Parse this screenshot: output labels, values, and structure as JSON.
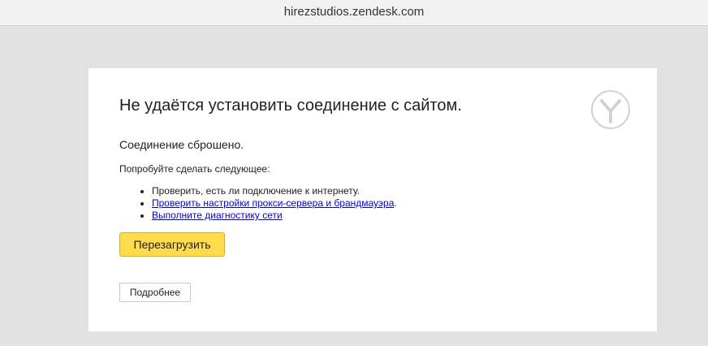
{
  "address_bar": {
    "url": "hirezstudios.zendesk.com"
  },
  "error": {
    "title": "Не удаётся установить соединение с сайтом.",
    "subtitle": "Соединение сброшено.",
    "try_label": "Попробуйте сделать следующее:",
    "suggestions": [
      {
        "text": "Проверить, есть ли подключение к интернету."
      },
      {
        "link": "Проверить настройки прокси-сервера и брандмауэра",
        "suffix": "."
      },
      {
        "link": "Выполните диагностику сети"
      }
    ],
    "reload_label": "Перезагрузить",
    "details_label": "Подробнее"
  },
  "logo": {
    "icon": "yandex-browser-logo-icon"
  },
  "colors": {
    "page_background": "#e1e1e1",
    "card_background": "#ffffff",
    "reload_button": "#ffdb4d",
    "link": "#0000ee"
  }
}
